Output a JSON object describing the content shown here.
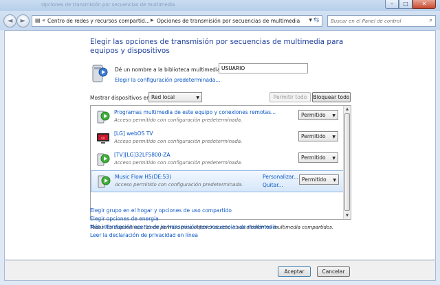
{
  "window": {
    "title": "Opciones de transmisión por secuencias de multimedia",
    "minimize": "–",
    "maximize": "□",
    "close": "✕"
  },
  "nav": {
    "back": "◄",
    "forward": "►",
    "breadcrumbs": [
      "Centro de redes y recursos compartid...",
      "Opciones de transmisión por secuencias de multimedia"
    ],
    "search_placeholder": "Buscar en el Panel de control"
  },
  "main": {
    "heading": "Elegir las opciones de transmisión por secuencias de multimedia para equipos y dispositivos",
    "library_label": "Dé un nombre a la biblioteca multimedia:",
    "library_value": "USUARIO",
    "default_config_link": "Elegir la configuración predeterminada...",
    "show_devices_label": "Mostrar dispositivos en:",
    "show_devices_value": "Red local",
    "permit_all": "Permitir todo",
    "block_all": "Bloquear todo"
  },
  "devices": [
    {
      "name": "Programas multimedia de este equipo y conexiones remotas...",
      "status": "Acceso permitido con configuración predeterminada.",
      "access": "Permitido",
      "icon": "media-server-icon"
    },
    {
      "name": "[LG] webOS TV",
      "status": "Acceso permitido con configuración predeterminada.",
      "access": "Permitido",
      "icon": "tv-icon"
    },
    {
      "name": "[TV][LG]32LF5800-ZA",
      "status": "Acceso permitido con configuración predeterminada.",
      "access": "Permitido",
      "icon": "media-device-icon"
    },
    {
      "name": "Music Flow H5(DE:53)",
      "status": "Acceso permitido con configuración predeterminada.",
      "access": "Permitido",
      "icon": "media-device-icon",
      "customize": "Personalizar...",
      "remove": "Quitar..."
    }
  ],
  "note": "Todos los dispositivos tienen permiso para obtener acceso a sus elementos multimedia compartidos.",
  "links": [
    "Elegir grupo en el hogar y opciones de uso compartido",
    "Elegir opciones de energía",
    "Más información acerca de la transmisión por secuencias de multimedia",
    "Leer la declaración de privacidad en línea"
  ],
  "footer": {
    "ok": "Aceptar",
    "cancel": "Cancelar"
  },
  "colors": {
    "heading": "#1e3e9a",
    "link": "#0a56c4",
    "selected_row": "#d6e7fa"
  }
}
